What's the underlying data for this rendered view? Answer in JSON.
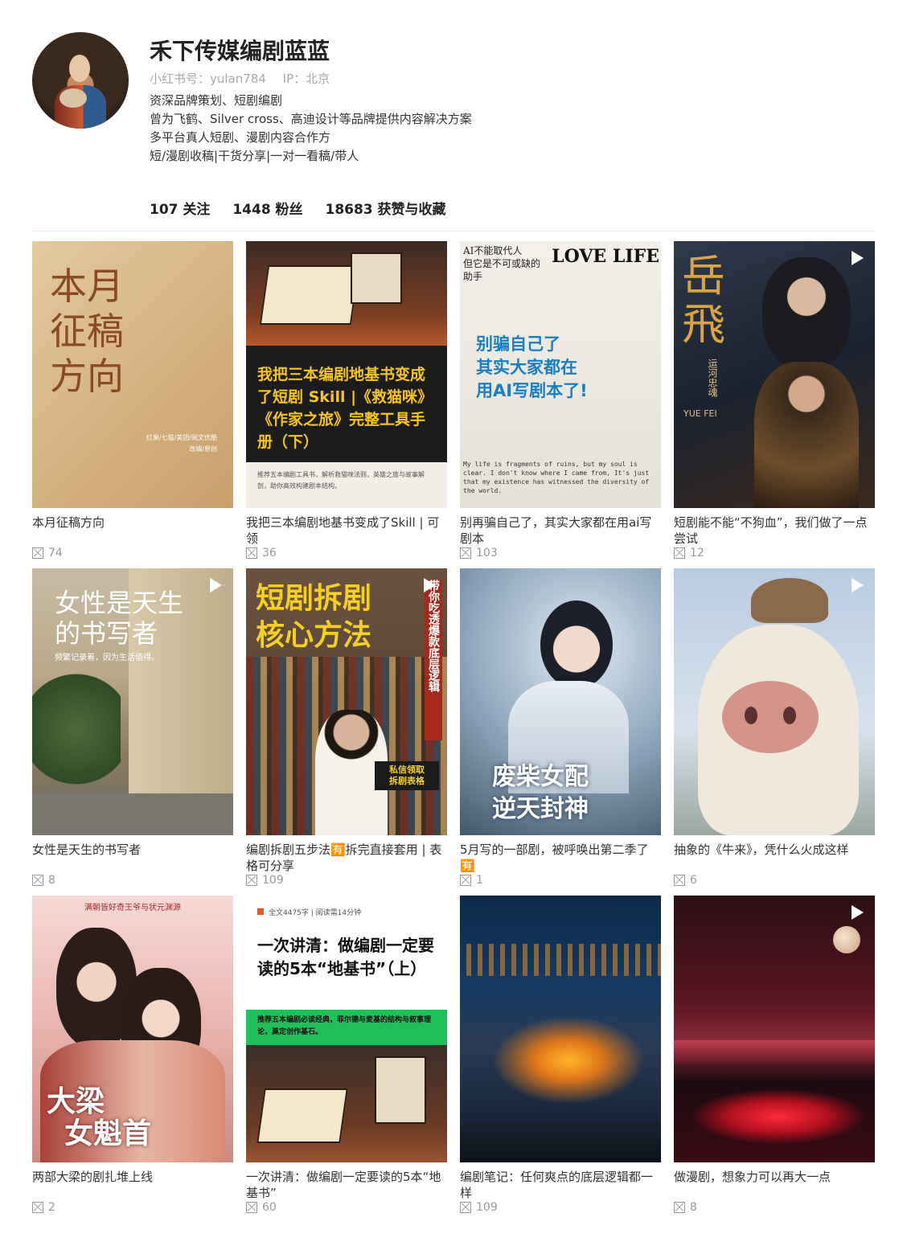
{
  "profile": {
    "name": "禾下传媒编剧蓝蓝",
    "id_label": "小红书号：yulan784",
    "ip_label": "IP：北京",
    "bio": [
      "资深品牌策划、短剧编剧",
      "曾为飞鹤、Silver cross、高迪设计等品牌提供内容解决方案",
      "多平台真人短剧、漫剧内容合作方",
      "短/漫剧收稿|干货分享|一对一看稿/带人"
    ],
    "stats": {
      "following": "107 关注",
      "followers": "1448 粉丝",
      "likes": "18683 获赞与收藏"
    }
  },
  "posts": [
    {
      "title": "本月征稿方向",
      "likes": "74",
      "video": false,
      "cover": {
        "big": [
          "本月",
          "征稿",
          "方向"
        ],
        "small": [
          "红果/七猫/美团/阅文优酷",
          "改编/原创"
        ]
      }
    },
    {
      "title": "我把三本编剧地基书变成了Skill | 可领",
      "likes": "36",
      "video": false,
      "cover": {
        "headline": "我把三本编剧地基书变成了短剧 Skill |《救猫咪》《作家之旅》完整工具手册（下）",
        "sub": "推荐五本编剧工具书，解析救猫咪法则，英雄之旅与故事解剖，助你高效构建剧本结构。"
      }
    },
    {
      "title": "别再骗自己了，其实大家都在用ai写剧本",
      "likes": "103",
      "video": false,
      "cover": {
        "top": [
          "AI不能取代人",
          "但它是不可或缺的",
          "助手"
        ],
        "brand": "LOVE LIFE",
        "headline": [
          "别骗自己了",
          "其实大家都在",
          "用AI写剧本了!"
        ],
        "bottom": "My life is fragments of ruins, but my soul is clear. I don't know where I came from, It's just that my existence has witnessed the diversity of the world."
      }
    },
    {
      "title": "短剧能不能“不狗血”，我们做了一点尝试",
      "likes": "12",
      "video": true,
      "cover": {
        "big": "岳飛",
        "sub": "运河忠魂",
        "en": "YUE FEI"
      }
    },
    {
      "title": "女性是天生的书写者",
      "likes": "8",
      "video": true,
      "cover": {
        "headline": [
          "女性是天生",
          "的书写者"
        ],
        "sub": "频繁记录着，因为生活值得。"
      }
    },
    {
      "title": "编剧拆剧五步法🈶拆完直接套用 | 表格可分享",
      "likes": "109",
      "video": true,
      "cover": {
        "headline": [
          "短剧拆剧",
          "核心方法"
        ],
        "side": "带你吃透爆款底层逻辑",
        "badge": [
          "私信领取",
          "拆剧表格"
        ]
      }
    },
    {
      "title": "5月写的一部剧，被呼唤出第二季了🈶",
      "likes": "1",
      "video": false,
      "cover": {
        "headline": [
          "废柴女配",
          "逆天封神"
        ]
      }
    },
    {
      "title": "抽象的《牛来》，凭什么火成这样",
      "likes": "6",
      "video": true,
      "cover": {}
    },
    {
      "title": "两部大梁的剧扎堆上线",
      "likes": "2",
      "video": false,
      "cover": {
        "top": "满朝皆好奇王爷与状元渊源",
        "headline": [
          "大梁",
          "女魁首"
        ]
      }
    },
    {
      "title": "一次讲清：做编剧一定要读的5本“地基书”",
      "likes": "60",
      "video": false,
      "cover": {
        "meta": "全文4475字 | 阅读需14分钟",
        "headline": "一次讲清：做编剧一定要读的5本“地基书”（上）",
        "sub": "推荐五本编剧必读经典，菲尔德与麦基的结构与叙事理论，奠定创作基石。"
      }
    },
    {
      "title": "编剧笔记：任何爽点的底层逻辑都一样",
      "likes": "109",
      "video": false,
      "cover": {}
    },
    {
      "title": "做漫剧，想象力可以再大一点",
      "likes": "8",
      "video": true,
      "cover": {}
    }
  ]
}
